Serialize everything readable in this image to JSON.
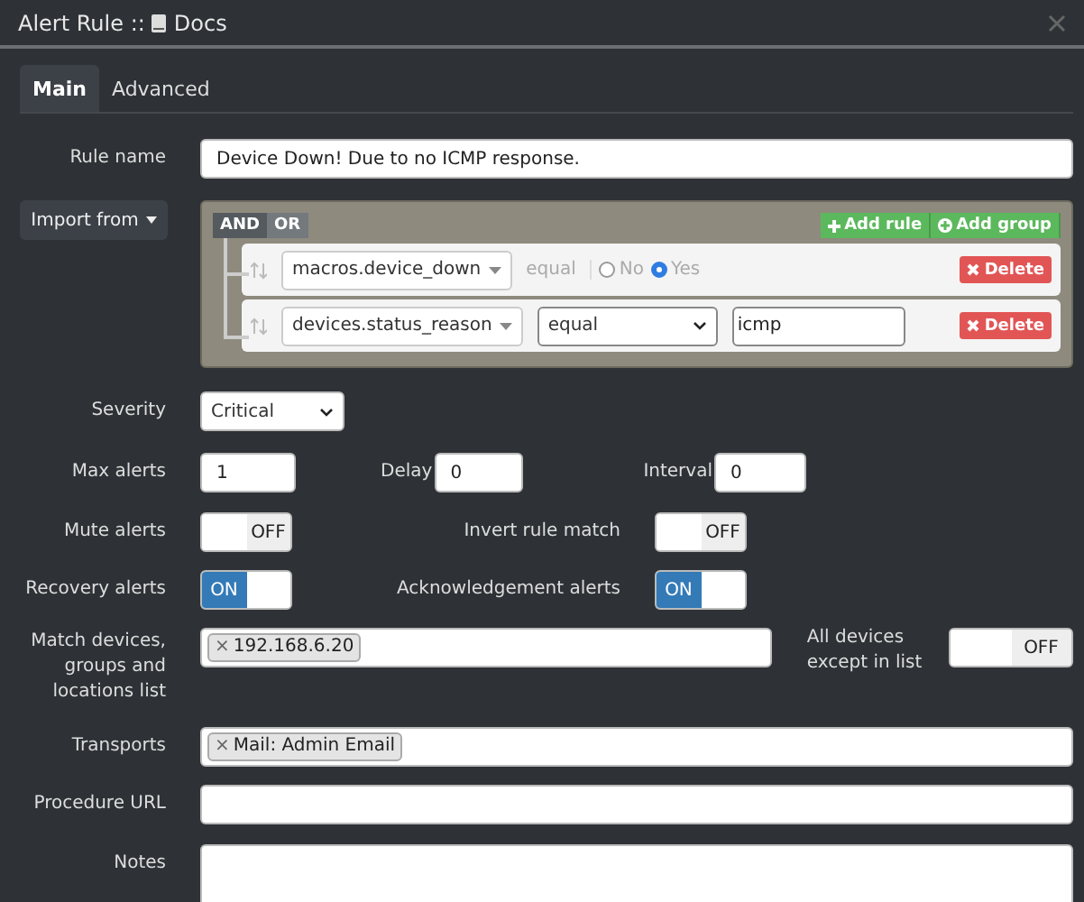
{
  "window": {
    "title": "Alert Rule ::",
    "link": "Docs"
  },
  "tabs": [
    {
      "label": "Main",
      "selected": true
    },
    {
      "label": "Advanced",
      "selected": false
    }
  ],
  "rule_name": {
    "label": "Rule name",
    "value": "Device Down! Due to no ICMP response."
  },
  "import_button": "Import from",
  "query": {
    "conditions": [
      {
        "label": "AND",
        "selected": true
      },
      {
        "label": "OR",
        "selected": false
      }
    ],
    "add_rule": "Add rule",
    "add_group": "Add group",
    "rules": [
      {
        "kind": "radio",
        "field": "macros.device_down",
        "operator": "equal",
        "options": [
          {
            "label": "No",
            "selected": false
          },
          {
            "label": "Yes",
            "selected": true
          }
        ],
        "delete": "Delete"
      },
      {
        "kind": "text",
        "field": "devices.status_reason",
        "operator": "equal",
        "value": "icmp",
        "delete": "Delete"
      }
    ]
  },
  "severity": {
    "label": "Severity",
    "value": "Critical"
  },
  "numbers": [
    {
      "label": "Max alerts",
      "value": "1"
    },
    {
      "label": "Delay",
      "value": "0"
    },
    {
      "label": "Interval",
      "value": "0"
    }
  ],
  "toggle_rows": [
    [
      {
        "label": "Mute alerts",
        "on": false,
        "state": "OFF"
      },
      {
        "label": "Invert rule match",
        "on": false,
        "state": "OFF"
      }
    ],
    [
      {
        "label": "Recovery alerts",
        "on": true,
        "state": "ON"
      },
      {
        "label": "Acknowledgement alerts",
        "on": true,
        "state": "ON"
      }
    ]
  ],
  "match": {
    "label": "Match devices, groups and locations list",
    "tags": [
      {
        "label": "192.168.6.20",
        "remove": "×"
      }
    ],
    "except_label": "All devices except in list",
    "except": {
      "on": false,
      "state": "OFF"
    }
  },
  "transports": {
    "label": "Transports",
    "tags": [
      {
        "label": "Mail: Admin Email",
        "remove": "×"
      }
    ]
  },
  "procedure_url": {
    "label": "Procedure URL"
  },
  "notes": {
    "label": "Notes"
  }
}
